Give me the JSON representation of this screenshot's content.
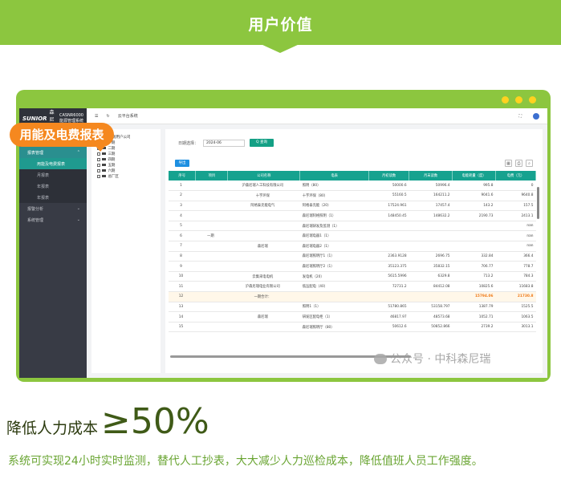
{
  "banner": {
    "title": "用户价值"
  },
  "app": {
    "logo_brand": "SUNIOR",
    "logo_name": "森尼瑞",
    "logo_system_line1": "CASNR6000",
    "logo_system_line2": "能源管理系统",
    "topbar_label": "云平台系统",
    "feature_tag": "用能及电费报表"
  },
  "sidebar": {
    "groups": [
      {
        "label": "报表管理",
        "active": true
      },
      {
        "label": "报警分析"
      },
      {
        "label": "系统管理"
      }
    ],
    "subitems": [
      "用能及电费报表",
      "月报表",
      "年报表",
      "年报表"
    ]
  },
  "tree": {
    "root": "森尼瑞用户公司",
    "nodes": [
      "一期",
      "二期",
      "三期",
      "四期",
      "五期",
      "六期",
      "总厂区"
    ]
  },
  "filter": {
    "date_label": "日期选择：",
    "date_value": "2024-06",
    "query_label": "Q 查询"
  },
  "export_label": "导出",
  "table": {
    "headers": [
      "序号",
      "项目",
      "公司名称",
      "电表",
      "月初读数",
      "月末读数",
      "电能耗量（度）",
      "电费（元）"
    ],
    "rows": [
      [
        "1",
        "",
        "沪森尼瑞人工科技有限公司",
        "照明（80）",
        "50000.6",
        "50996.4",
        "995.8",
        "0"
      ],
      [
        "2",
        "",
        "十字环保",
        "十字环保（80）",
        "55160.5",
        "164211.2",
        "9041.6",
        "9640.8"
      ],
      [
        "3",
        "",
        "阿格泰克能电气",
        "阿格泰克能（20）",
        "17524.961",
        "17457.4",
        "143.2",
        "157.5"
      ],
      [
        "4",
        "",
        "",
        "森尼瑞阿格照明（1）",
        "148450.45",
        "148632.2",
        "2190.73",
        "2413.1"
      ],
      [
        "5",
        "",
        "",
        "森尼瑞研发及监测（1）",
        "",
        "",
        "",
        "nan"
      ],
      [
        "6",
        "一期",
        "",
        "森尼瑞电器1（1）",
        "",
        "",
        "",
        "nan"
      ],
      [
        "7",
        "",
        "森尼瑞",
        "森尼瑞电器2（1）",
        "",
        "",
        "",
        "nan"
      ],
      [
        "8",
        "",
        "",
        "森尼瑞照明厅1（1）",
        "2363.9128",
        "2696.75",
        "332.84",
        "366.4"
      ],
      [
        "9",
        "",
        "",
        "森尼瑞照明厅2（1）",
        "35123.375",
        "35832.15",
        "706.77",
        "778.7"
      ],
      [
        "10",
        "",
        "云集采电电机",
        "发电机（20）",
        "5615.5996",
        "6329.8",
        "713.2",
        "784.3"
      ],
      [
        "11",
        "",
        "沪森尼瑞电业有限公司",
        "低压配电（40）",
        "72731.2",
        "84412.08",
        "10825.6",
        "11683.8"
      ],
      [
        "12",
        "",
        "一期合计：",
        "",
        "",
        "",
        "15794.06",
        "21730.8"
      ],
      [
        "13",
        "",
        "",
        "照明1（1）",
        "51780.865",
        "53158.797",
        "1387.79",
        "1525.5"
      ],
      [
        "14",
        "",
        "森尼瑞",
        "研发区配电柜（1）",
        "46817.97",
        "48573.68",
        "1052.71",
        "1063.5"
      ],
      [
        "15",
        "",
        "",
        "森尼瑞照明厅（80）",
        "50612.6",
        "50852.866",
        "2739.2",
        "3013.1"
      ]
    ]
  },
  "watermark": "公众号 · 中科森尼瑞",
  "headline": {
    "text": "降低人力成本",
    "value": "≥50%"
  },
  "description": "系统可实现24小时实时监测，替代人工抄表，大大减少人力巡检成本，降低值班人员工作强度。",
  "colors": {
    "brand_green": "#8cc63f",
    "tag_orange": "#f5881f",
    "table_header": "#16a28f",
    "desc_green": "#6aa533"
  }
}
